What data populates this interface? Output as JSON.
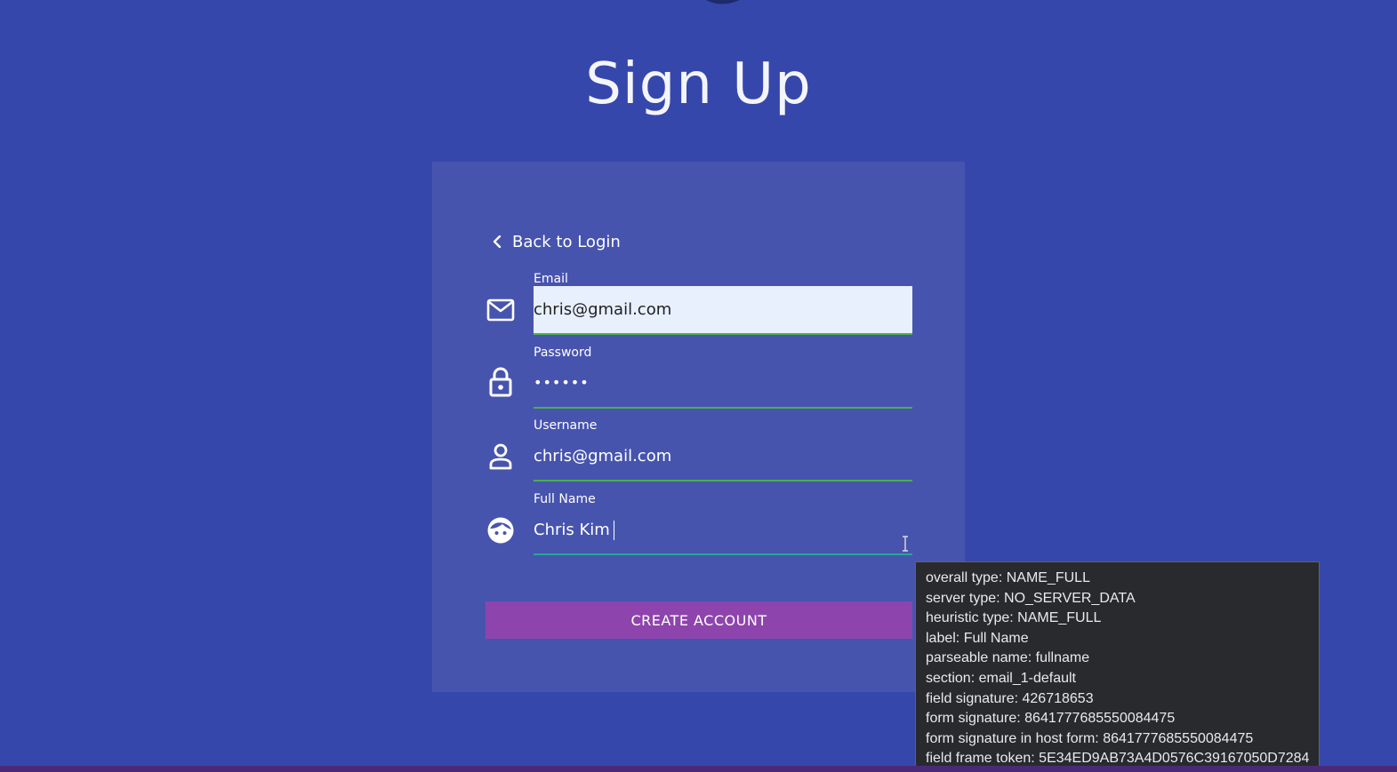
{
  "page": {
    "title": "Sign Up",
    "back_link": "Back to Login"
  },
  "fields": {
    "email": {
      "label": "Email",
      "value": "chris@gmail.com"
    },
    "password": {
      "label": "Password",
      "value": "••••••"
    },
    "username": {
      "label": "Username",
      "value": "chris@gmail.com"
    },
    "fullname": {
      "label": "Full Name",
      "value": "Chris Kim"
    }
  },
  "actions": {
    "create_account": "CREATE ACCOUNT"
  },
  "autofill_tooltip": {
    "lines": [
      "overall type: NAME_FULL",
      "server type: NO_SERVER_DATA",
      "heuristic type: NAME_FULL",
      "label: Full Name",
      "parseable name: fullname",
      "section: email_1-default",
      "field signature: 426718653",
      "form signature: 8641777685550084475",
      "form signature in host form: 8641777685550084475",
      "field frame token: 5E34ED9AB73A4D0576C39167050D7284"
    ]
  },
  "icons": {
    "email": "envelope-icon",
    "password": "lock-icon",
    "username": "person-icon",
    "fullname": "face-icon",
    "back": "chevron-left-icon"
  },
  "colors": {
    "background": "#3647ac",
    "card": "#4754ae",
    "accent_underline": "#4caf50",
    "button": "#8e44ad",
    "autofill_bg": "#e8f0fe",
    "tooltip_bg": "#292a2d"
  }
}
